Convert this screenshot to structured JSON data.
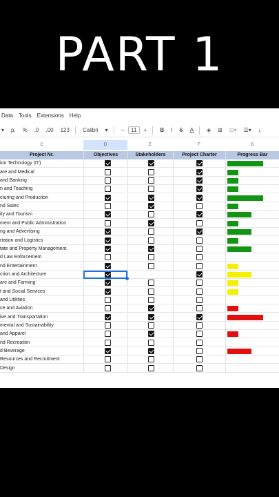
{
  "title": "PART 1",
  "menu": [
    "Data",
    "Tools",
    "Extensions",
    "Help"
  ],
  "toolbar": {
    "items": [
      "▾",
      "p.",
      "%",
      ".0",
      ".00",
      "123"
    ],
    "font": "Calibri",
    "font_size": "11",
    "minus": "−",
    "plus": "+",
    "bold": "B",
    "italic": "I",
    "strike": "S",
    "text_color": "A"
  },
  "columns": {
    "c": "C",
    "d": "D",
    "e": "E",
    "f": "F",
    "g": "G"
  },
  "headers": {
    "name": "Project Nr.",
    "objectives": "Objectives",
    "stakeholders": "Stakeholders",
    "charter": "Project Charter",
    "progress": "Progress Bar"
  },
  "colors": {
    "green": "#149414",
    "yellow": "#f5f000",
    "red": "#e01010"
  },
  "rows": [
    {
      "name": "ion Technology (IT)",
      "d": true,
      "e": true,
      "f": true,
      "progress": 0.7,
      "color": "green"
    },
    {
      "name": "are and Medical",
      "d": false,
      "e": false,
      "f": true,
      "progress": 0.22,
      "color": "green"
    },
    {
      "name": "and Banking",
      "d": false,
      "e": false,
      "f": true,
      "progress": 0.22,
      "color": "green"
    },
    {
      "name": "n and Teaching",
      "d": false,
      "e": false,
      "f": true,
      "progress": 0.22,
      "color": "green"
    },
    {
      "name": "cturing and Production",
      "d": true,
      "e": true,
      "f": true,
      "progress": 0.7,
      "color": "green"
    },
    {
      "name": "nd Sales",
      "d": false,
      "e": true,
      "f": false,
      "progress": 0.22,
      "color": "green"
    },
    {
      "name": "ity and Tourism",
      "d": true,
      "e": false,
      "f": true,
      "progress": 0.47,
      "color": "green"
    },
    {
      "name": "ment and Public Administration",
      "d": false,
      "e": true,
      "f": false,
      "progress": 0.22,
      "color": "green"
    },
    {
      "name": "ng and Advertising",
      "d": true,
      "e": false,
      "f": true,
      "progress": 0.47,
      "color": "green"
    },
    {
      "name": "rtation and Logistics",
      "d": true,
      "e": false,
      "f": false,
      "progress": 0.22,
      "color": "green"
    },
    {
      "name": "tate and Property Management",
      "d": true,
      "e": true,
      "f": false,
      "progress": 0.47,
      "color": "green"
    },
    {
      "name": "d Law Enforcement",
      "d": false,
      "e": false,
      "f": false,
      "progress": 0,
      "color": "green"
    },
    {
      "name": "nd Entertainment",
      "d": true,
      "e": false,
      "f": false,
      "progress": 0.22,
      "color": "yellow"
    },
    {
      "name": "ction and Architecture",
      "d": true,
      "e": null,
      "f": true,
      "progress": 0.47,
      "color": "yellow"
    },
    {
      "name": "are and Farming",
      "d": true,
      "e": false,
      "f": false,
      "progress": 0.22,
      "color": "yellow"
    },
    {
      "name": "t and Social Services",
      "d": true,
      "e": false,
      "f": false,
      "progress": 0.22,
      "color": "yellow"
    },
    {
      "name": "and Utilities",
      "d": false,
      "e": false,
      "f": false,
      "progress": 0,
      "color": "yellow"
    },
    {
      "name": "ce and Aviation",
      "d": false,
      "e": true,
      "f": false,
      "progress": 0.22,
      "color": "red"
    },
    {
      "name": "ive and Transportation",
      "d": true,
      "e": true,
      "f": true,
      "progress": 0.7,
      "color": "red"
    },
    {
      "name": "mental and Sustainability",
      "d": false,
      "e": false,
      "f": false,
      "progress": 0,
      "color": "red"
    },
    {
      "name": " and Apparel",
      "d": false,
      "e": true,
      "f": false,
      "progress": 0.22,
      "color": "red"
    },
    {
      "name": "nd Recreation",
      "d": false,
      "e": false,
      "f": false,
      "progress": 0,
      "color": "red"
    },
    {
      "name": "d Beverage",
      "d": true,
      "e": true,
      "f": false,
      "progress": 0.47,
      "color": "red"
    },
    {
      "name": " Resources and Recruitment",
      "d": false,
      "e": false,
      "f": false,
      "progress": 0,
      "color": "red"
    },
    {
      "name": "Design",
      "d": false,
      "e": false,
      "f": false,
      "progress": 0,
      "color": "red"
    }
  ]
}
